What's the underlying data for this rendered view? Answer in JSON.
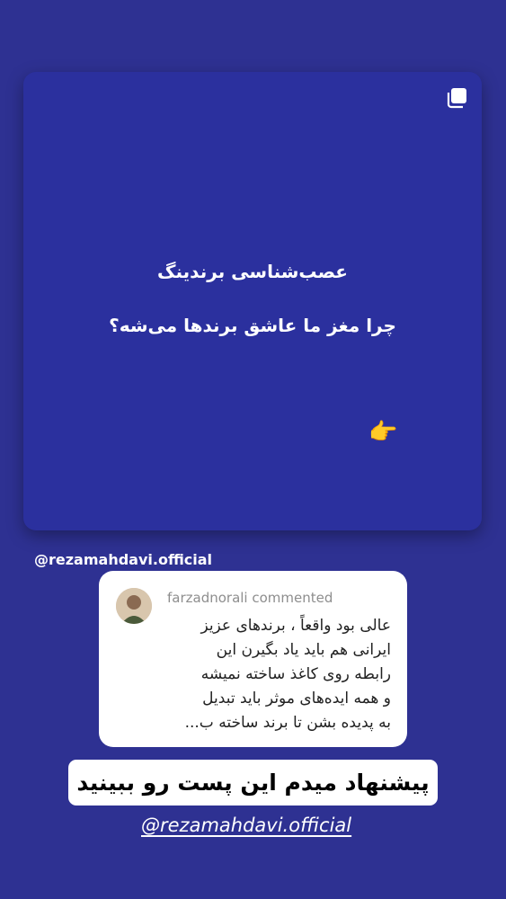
{
  "card": {
    "title": "عصب‌شناسی برندینگ",
    "subtitle": "چرا مغز ما عاشق برندها می‌شه؟",
    "pointer": "👉",
    "multi_icon": "carousel-icon"
  },
  "handle": "@rezamahdavi.official",
  "comment": {
    "author_line": "farzadnorali commented",
    "text": "عالی بود واقعاً ، برندهای عزیز\nایرانی هم باید یاد بگیرن این\nرابطه روی کاغذ ساخته نمیشه\nو همه ایده‌های موثر باید تبدیل\nبه پدیده بشن تا برند ساخته ب..."
  },
  "suggestion": "پیشنهاد میدم این پست رو ببینید",
  "tag": "@rezamahdavi.official"
}
